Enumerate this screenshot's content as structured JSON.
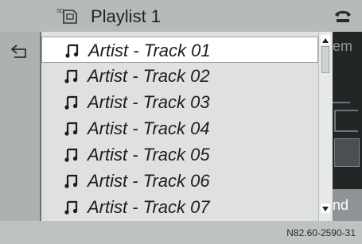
{
  "header": {
    "title": "Playlist 1",
    "sd_icon_label": "SD",
    "icons": {
      "sd": "sd-card-icon",
      "phone": "phone-icon"
    }
  },
  "left": {
    "icon": "back-icon"
  },
  "right_strip": {
    "top_text": "em",
    "bottom_text": "nd"
  },
  "tracks": [
    {
      "label": "Artist - Track 01",
      "selected": true
    },
    {
      "label": "Artist - Track 02",
      "selected": false
    },
    {
      "label": "Artist - Track 03",
      "selected": false
    },
    {
      "label": "Artist - Track 04",
      "selected": false
    },
    {
      "label": "Artist - Track 05",
      "selected": false
    },
    {
      "label": "Artist - Track 06",
      "selected": false
    },
    {
      "label": "Artist - Track 07",
      "selected": false
    }
  ],
  "footer": {
    "code": "N82.60-2590-31"
  },
  "colors": {
    "screen_bg": "#b9bcbd",
    "list_bg": "#dfe0e0",
    "selected_bg": "#ffffff",
    "dark_strip": "#232627"
  }
}
